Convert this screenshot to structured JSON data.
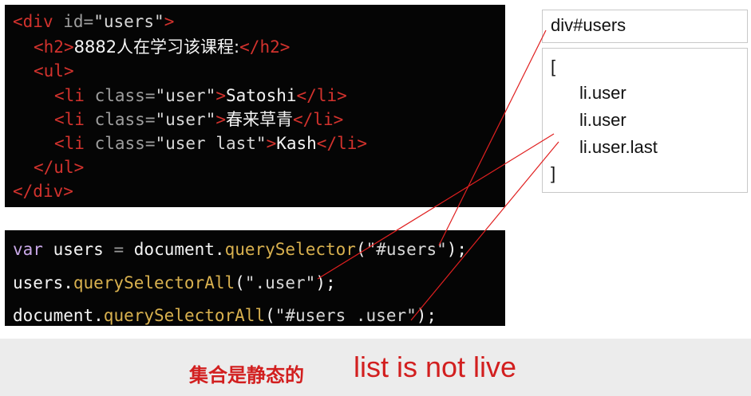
{
  "html_code": {
    "line1": {
      "tag": "div",
      "attr": "id",
      "val": "\"users\""
    },
    "line2": {
      "tag": "h2",
      "text": "8882人在学习该课程:"
    },
    "line3": {
      "tag": "ul"
    },
    "li": [
      {
        "tag": "li",
        "attr": "class",
        "val": "\"user\"",
        "text": "Satoshi"
      },
      {
        "tag": "li",
        "attr": "class",
        "val": "\"user\"",
        "text": "春来草青"
      },
      {
        "tag": "li",
        "attr": "class",
        "val": "\"user last\"",
        "text": "Kash"
      }
    ]
  },
  "js_code": {
    "line1": {
      "kw": "var",
      "name": "users",
      "op": "=",
      "obj": "document.",
      "method": "querySelector",
      "arg": "\"#users\"",
      "end": ");"
    },
    "line2": {
      "obj": "users.",
      "method": "querySelectorAll",
      "arg": "\".user\"",
      "end": ");"
    },
    "line3": {
      "obj": "document.",
      "method": "querySelectorAll",
      "arg": "\"#users .user\"",
      "end": ");"
    }
  },
  "result_panel": {
    "top": "div#users",
    "open": "[",
    "items": [
      "li.user",
      "li.user",
      "li.user.last"
    ],
    "close": "]"
  },
  "caption": {
    "chinese": "集合是静态的",
    "english": "list is not live"
  },
  "colors": {
    "tag": "#d2322d",
    "annotation_line": "#e02020",
    "caption": "#d21f1f"
  }
}
